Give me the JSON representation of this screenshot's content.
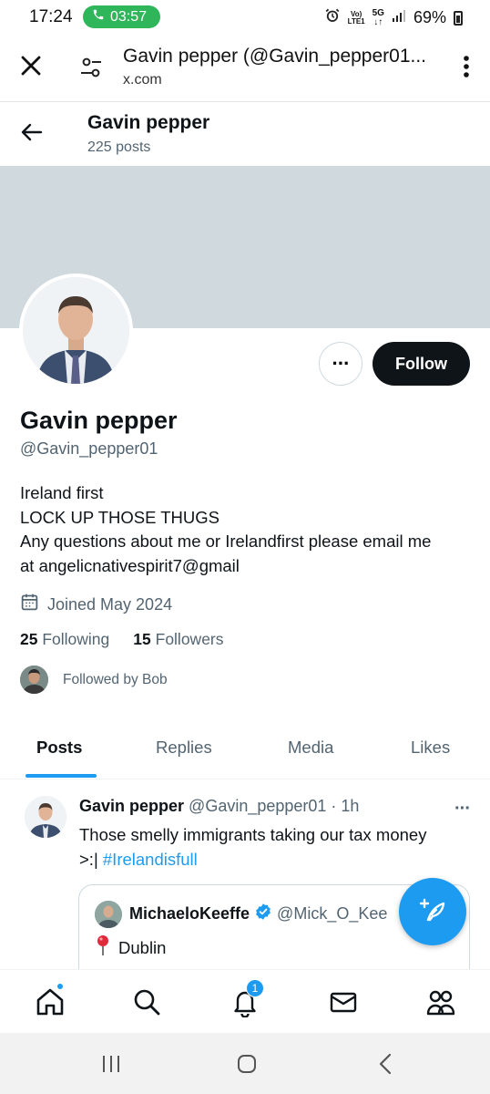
{
  "status_bar": {
    "time": "17:24",
    "call_duration": "03:57",
    "network_top": "Vo)",
    "network_bottom": "LTE1",
    "net_type": "5G",
    "battery": "69%"
  },
  "browser": {
    "title": "Gavin pepper (@Gavin_pepper01...",
    "url": "x.com"
  },
  "header": {
    "name": "Gavin pepper",
    "posts_count": "225 posts"
  },
  "profile": {
    "display_name": "Gavin pepper",
    "handle": "@Gavin_pepper01",
    "follow_label": "Follow",
    "more_label": "···",
    "bio_lines": [
      "Ireland first",
      "LOCK UP THOSE THUGS",
      "Any questions about me or Irelandfirst please email me",
      "at angelicnativespirit7@gmail"
    ],
    "joined": "Joined May 2024",
    "following_count": "25",
    "following_label": "Following",
    "followers_count": "15",
    "followers_label": "Followers",
    "followed_by": "Followed by Bob"
  },
  "tabs": [
    "Posts",
    "Replies",
    "Media",
    "Likes"
  ],
  "post": {
    "name": "Gavin pepper",
    "meta": "@Gavin_pepper01 · 1h",
    "more": "···",
    "text_line1": "Those smelly immigrants taking our tax money",
    "text_line2_prefix": ">:| ",
    "hashtag": "#Irelandisfull",
    "quote": {
      "name": "MichaeloKeeffe",
      "handle": "@Mick_O_Kee",
      "location": "Dublin"
    }
  },
  "bottom_nav": {
    "notifications_badge": "1"
  },
  "colors": {
    "accent": "#1d9bf0",
    "banner": "#cfd9de",
    "secondary_text": "#536471",
    "call_pill": "#2fb55a"
  }
}
